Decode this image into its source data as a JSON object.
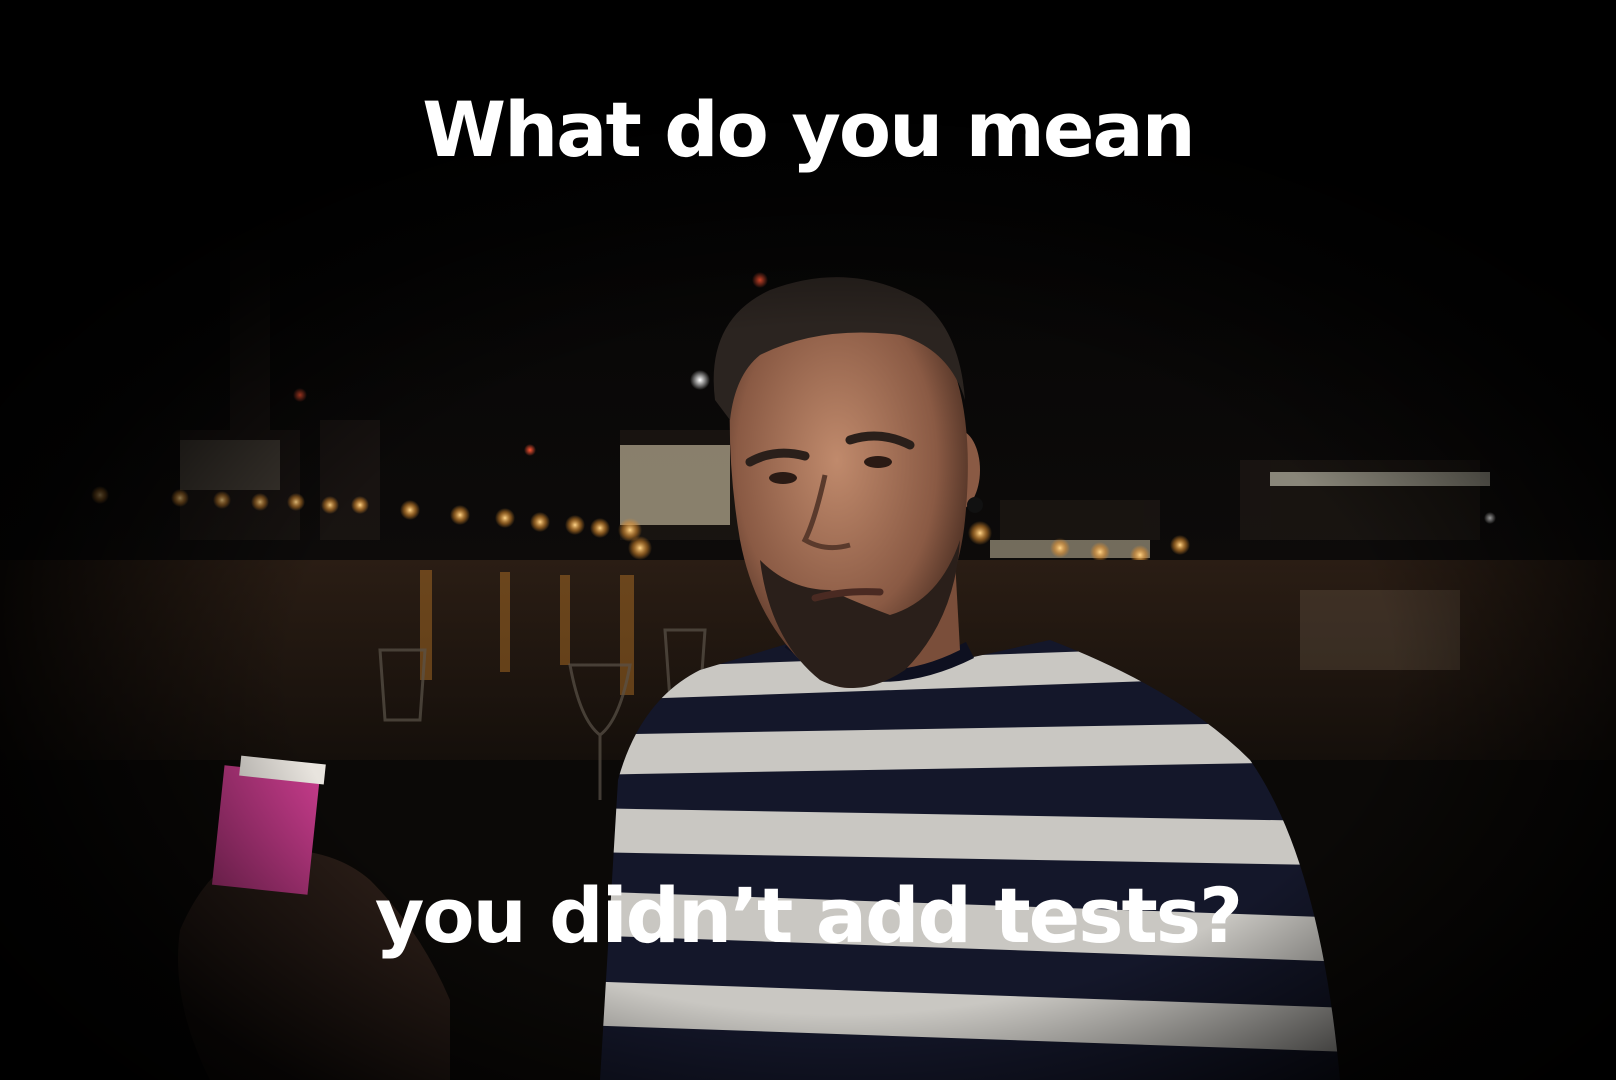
{
  "meme": {
    "caption_top": "What do you mean",
    "caption_bottom": "you didn’t add tests?"
  },
  "colors": {
    "caption_text": "#ffffff",
    "background": "#000000",
    "shirt_dark_stripe": "#14172a",
    "shirt_light_stripe": "#c9c7c2",
    "skin": "#a8745a",
    "city_lights": "#f2b04a"
  },
  "scene": {
    "subject": "man in striped t-shirt",
    "setting": "night riverside city skyline",
    "foreground_object": "pink cigarette pack"
  }
}
